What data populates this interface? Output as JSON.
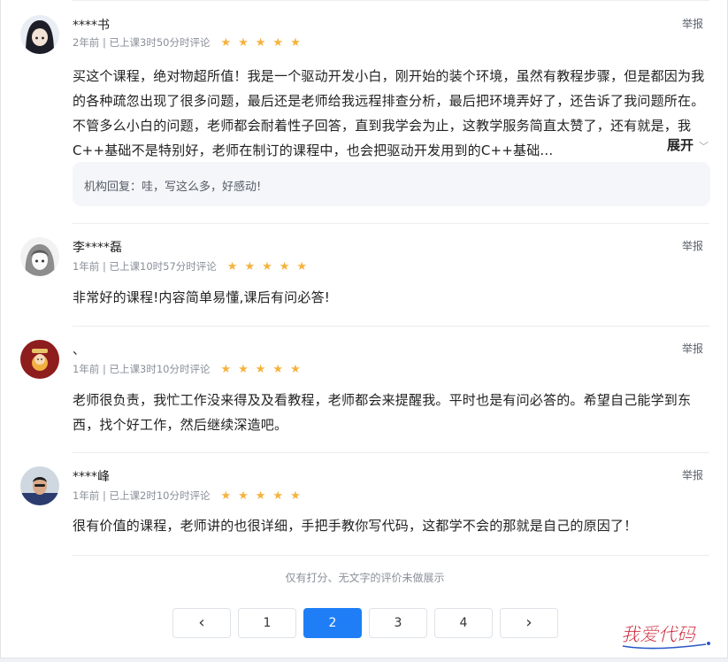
{
  "reviews": [
    {
      "username": "****书",
      "meta": "2年前 | 已上课3时50分时评论",
      "rating": 5,
      "report_label": "举报",
      "content": "买这个课程，绝对物超所值！我是一个驱动开发小白，刚开始的装个环境，虽然有教程步骤，但是都因为我的各种疏忽出现了很多问题，最后还是老师给我远程排查分析，最后把环境弄好了，还告诉了我问题所在。不管多么小白的问题，老师都会耐着性子回答，直到我学会为止，这教学服务简直太赞了，还有就是，我C++基础不是特别好，老师在制订的课程中，也会把驱动开发用到的C++基础...",
      "expand_label": "展开",
      "reply": "机构回复：哇，写这么多，好感动!"
    },
    {
      "username": "李****磊",
      "meta": "1年前 | 已上课10时57分时评论",
      "rating": 5,
      "report_label": "举报",
      "content": "非常好的课程!内容简单易懂,课后有问必答!"
    },
    {
      "username": "、",
      "meta": "1年前 | 已上课3时10分时评论",
      "rating": 5,
      "report_label": "举报",
      "content": "老师很负责，我忙工作没来得及及看教程，老师都会来提醒我。平时也是有问必答的。希望自己能学到东西，找个好工作，然后继续深造吧。"
    },
    {
      "username": "****峰",
      "meta": "1年前 | 已上课2时10分时评论",
      "rating": 5,
      "report_label": "举报",
      "content": "很有价值的课程，老师讲的也很详细，手把手教你写代码，这都学不会的那就是自己的原因了！"
    }
  ],
  "footer_note": "仅有打分、无文字的评价未做展示",
  "pagination": {
    "prev": "‹",
    "pages": [
      "1",
      "2",
      "3",
      "4"
    ],
    "current": "2",
    "next": "›"
  },
  "watermark": "我爱代码",
  "colors": {
    "accent": "#1f7ef6",
    "star": "#f6b23c"
  }
}
